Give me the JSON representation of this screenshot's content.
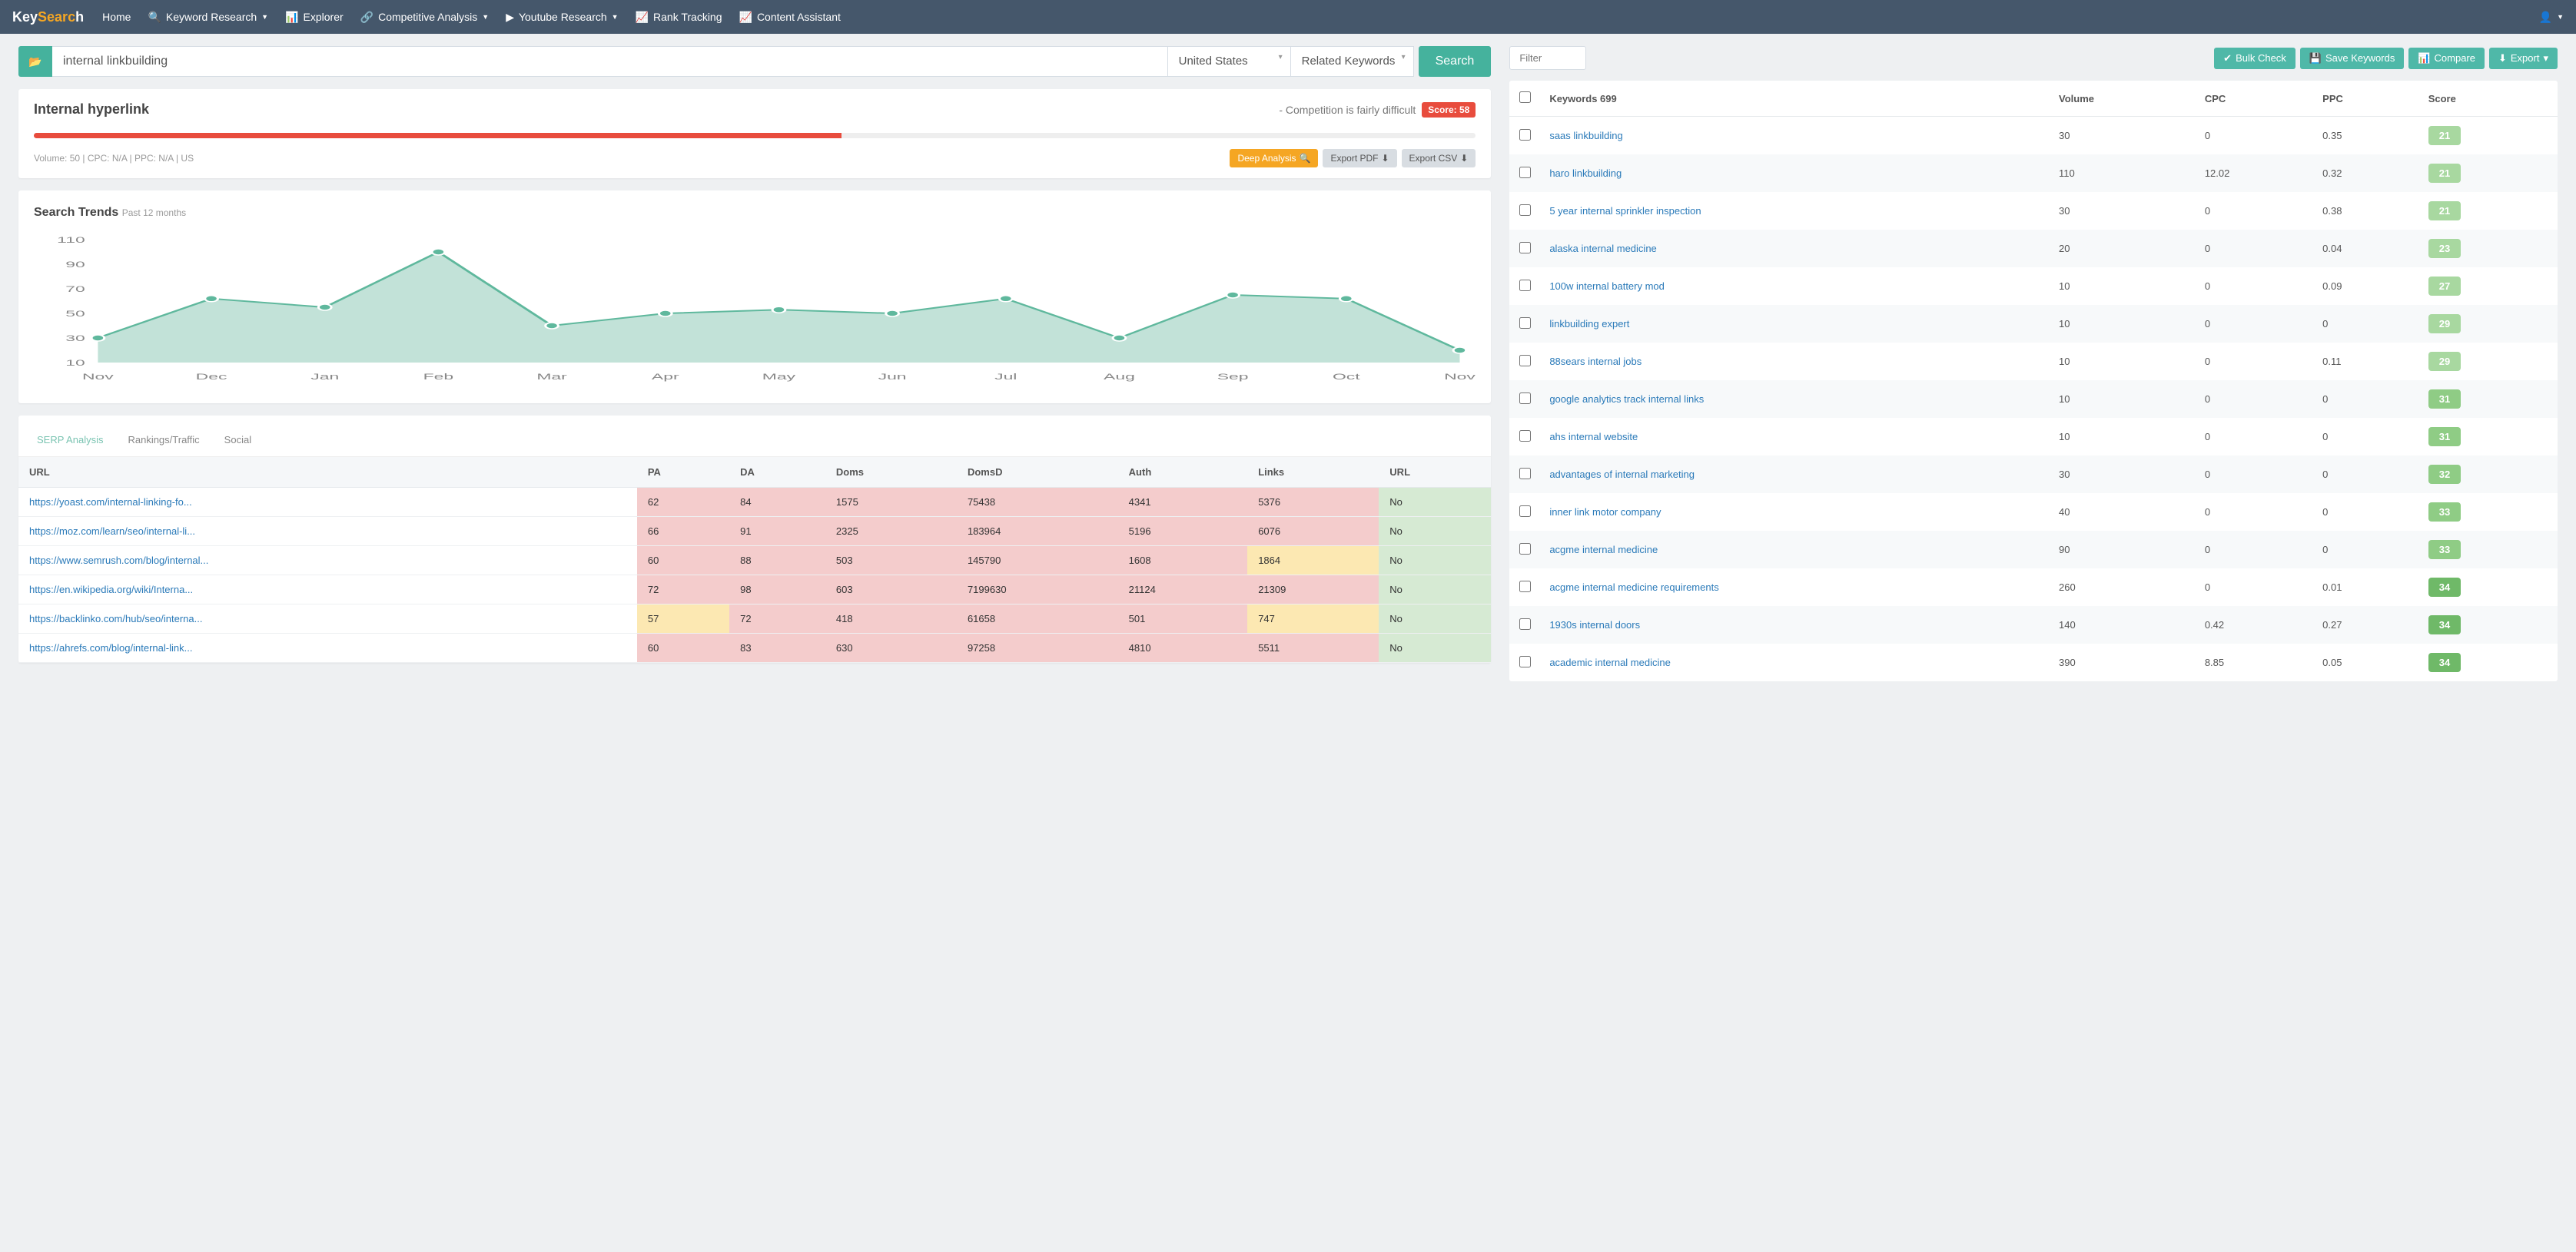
{
  "nav": {
    "logo_key": "Key",
    "logo_sear": "Searc",
    "logo_ch": "h",
    "home": "Home",
    "keyword_research": "Keyword Research",
    "explorer": "Explorer",
    "competitive": "Competitive Analysis",
    "youtube": "Youtube Research",
    "rank": "Rank Tracking",
    "content": "Content Assistant"
  },
  "search": {
    "query": "internal linkbuilding",
    "country": "United States",
    "mode": "Related Keywords",
    "button": "Search"
  },
  "overview": {
    "title": "Internal hyperlink",
    "competition_text": "- Competition is fairly difficult",
    "score_label": "Score: 58",
    "meta": "Volume: 50 | CPC: N/A | PPC: N/A | US",
    "deep_analysis": "Deep Analysis",
    "export_pdf": "Export PDF",
    "export_csv": "Export CSV"
  },
  "trends": {
    "title": "Search Trends",
    "subtitle": "Past 12 months"
  },
  "chart_data": {
    "type": "line",
    "categories": [
      "Nov",
      "Dec",
      "Jan",
      "Feb",
      "Mar",
      "Apr",
      "May",
      "Jun",
      "Jul",
      "Aug",
      "Sep",
      "Oct",
      "Nov"
    ],
    "values": [
      30,
      62,
      55,
      100,
      40,
      50,
      53,
      50,
      62,
      30,
      65,
      62,
      20
    ],
    "ylim": [
      10,
      110
    ],
    "yticks": [
      10,
      30,
      50,
      70,
      90,
      110
    ],
    "xlabel": "",
    "ylabel": "",
    "title": "Search Trends Past 12 months"
  },
  "serp": {
    "tabs": {
      "serp": "SERP Analysis",
      "rankings": "Rankings/Traffic",
      "social": "Social"
    },
    "headers": {
      "url": "URL",
      "pa": "PA",
      "da": "DA",
      "doms": "Doms",
      "domsd": "DomsD",
      "auth": "Auth",
      "links": "Links",
      "url2": "URL"
    },
    "rows": [
      {
        "url": "https://yoast.com/internal-linking-fo...",
        "pa": "62",
        "da": "84",
        "doms": "1575",
        "domsd": "75438",
        "auth": "4341",
        "links": "5376",
        "url2": "No",
        "pa_c": "red",
        "da_c": "red",
        "doms_c": "red",
        "domsd_c": "red",
        "auth_c": "red",
        "links_c": "red",
        "url2_c": "green"
      },
      {
        "url": "https://moz.com/learn/seo/internal-li...",
        "pa": "66",
        "da": "91",
        "doms": "2325",
        "domsd": "183964",
        "auth": "5196",
        "links": "6076",
        "url2": "No",
        "pa_c": "red",
        "da_c": "red",
        "doms_c": "red",
        "domsd_c": "red",
        "auth_c": "red",
        "links_c": "red",
        "url2_c": "green"
      },
      {
        "url": "https://www.semrush.com/blog/internal...",
        "pa": "60",
        "da": "88",
        "doms": "503",
        "domsd": "145790",
        "auth": "1608",
        "links": "1864",
        "url2": "No",
        "pa_c": "red",
        "da_c": "red",
        "doms_c": "red",
        "domsd_c": "red",
        "auth_c": "red",
        "links_c": "yellow",
        "url2_c": "green"
      },
      {
        "url": "https://en.wikipedia.org/wiki/Interna...",
        "pa": "72",
        "da": "98",
        "doms": "603",
        "domsd": "7199630",
        "auth": "21124",
        "links": "21309",
        "url2": "No",
        "pa_c": "red",
        "da_c": "red",
        "doms_c": "red",
        "domsd_c": "red",
        "auth_c": "red",
        "links_c": "red",
        "url2_c": "green"
      },
      {
        "url": "https://backlinko.com/hub/seo/interna...",
        "pa": "57",
        "da": "72",
        "doms": "418",
        "domsd": "61658",
        "auth": "501",
        "links": "747",
        "url2": "No",
        "pa_c": "yellow",
        "da_c": "red",
        "doms_c": "red",
        "domsd_c": "red",
        "auth_c": "red",
        "links_c": "yellow",
        "url2_c": "green"
      },
      {
        "url": "https://ahrefs.com/blog/internal-link...",
        "pa": "60",
        "da": "83",
        "doms": "630",
        "domsd": "97258",
        "auth": "4810",
        "links": "5511",
        "url2": "No",
        "pa_c": "red",
        "da_c": "red",
        "doms_c": "red",
        "domsd_c": "red",
        "auth_c": "red",
        "links_c": "red",
        "url2_c": "green"
      }
    ]
  },
  "right": {
    "filter_placeholder": "Filter",
    "bulk": "Bulk Check",
    "save": "Save Keywords",
    "compare": "Compare",
    "export": "Export"
  },
  "keywords": {
    "header": {
      "kw": "Keywords 699",
      "vol": "Volume",
      "cpc": "CPC",
      "ppc": "PPC",
      "score": "Score"
    },
    "rows": [
      {
        "kw": "saas linkbuilding",
        "vol": "30",
        "cpc": "0",
        "ppc": "0.35",
        "score": "21",
        "sc": "light"
      },
      {
        "kw": "haro linkbuilding",
        "vol": "110",
        "cpc": "12.02",
        "ppc": "0.32",
        "score": "21",
        "sc": "light"
      },
      {
        "kw": "5 year internal sprinkler inspection",
        "vol": "30",
        "cpc": "0",
        "ppc": "0.38",
        "score": "21",
        "sc": "light"
      },
      {
        "kw": "alaska internal medicine",
        "vol": "20",
        "cpc": "0",
        "ppc": "0.04",
        "score": "23",
        "sc": "light"
      },
      {
        "kw": "100w internal battery mod",
        "vol": "10",
        "cpc": "0",
        "ppc": "0.09",
        "score": "27",
        "sc": "light"
      },
      {
        "kw": "linkbuilding expert",
        "vol": "10",
        "cpc": "0",
        "ppc": "0",
        "score": "29",
        "sc": "light"
      },
      {
        "kw": "88sears internal jobs",
        "vol": "10",
        "cpc": "0",
        "ppc": "0.11",
        "score": "29",
        "sc": "light"
      },
      {
        "kw": "google analytics track internal links",
        "vol": "10",
        "cpc": "0",
        "ppc": "0",
        "score": "31",
        "sc": "mid"
      },
      {
        "kw": "ahs internal website",
        "vol": "10",
        "cpc": "0",
        "ppc": "0",
        "score": "31",
        "sc": "mid"
      },
      {
        "kw": "advantages of internal marketing",
        "vol": "30",
        "cpc": "0",
        "ppc": "0",
        "score": "32",
        "sc": "mid"
      },
      {
        "kw": "inner link motor company",
        "vol": "40",
        "cpc": "0",
        "ppc": "0",
        "score": "33",
        "sc": "mid"
      },
      {
        "kw": "acgme internal medicine",
        "vol": "90",
        "cpc": "0",
        "ppc": "0",
        "score": "33",
        "sc": "mid"
      },
      {
        "kw": "acgme internal medicine requirements",
        "vol": "260",
        "cpc": "0",
        "ppc": "0.01",
        "score": "34",
        "sc": "dark"
      },
      {
        "kw": "1930s internal doors",
        "vol": "140",
        "cpc": "0.42",
        "ppc": "0.27",
        "score": "34",
        "sc": "dark"
      },
      {
        "kw": "academic internal medicine",
        "vol": "390",
        "cpc": "8.85",
        "ppc": "0.05",
        "score": "34",
        "sc": "dark"
      }
    ]
  }
}
